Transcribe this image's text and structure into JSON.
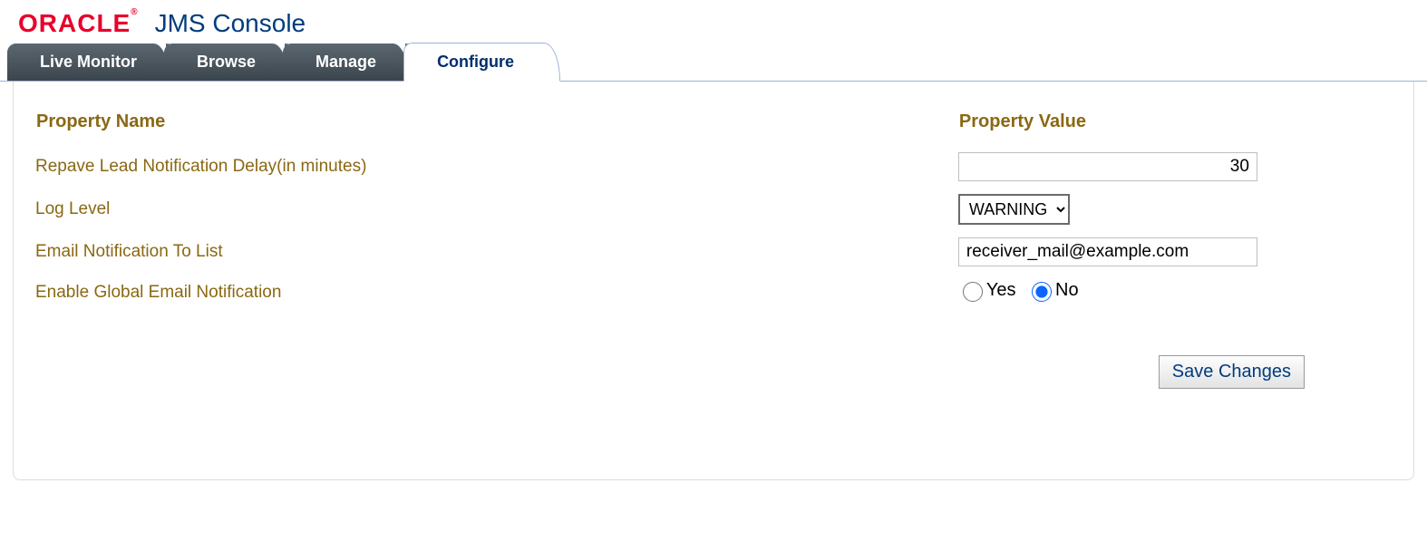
{
  "header": {
    "logo_text": "ORACLE",
    "logo_suffix": "®",
    "app_title": "JMS Console"
  },
  "tabs": [
    {
      "label": "Live Monitor",
      "active": false
    },
    {
      "label": "Browse",
      "active": false
    },
    {
      "label": "Manage",
      "active": false
    },
    {
      "label": "Configure",
      "active": true
    }
  ],
  "table": {
    "header_name": "Property Name",
    "header_value": "Property Value",
    "rows": {
      "delay": {
        "label": "Repave Lead Notification Delay(in minutes)",
        "value": "30"
      },
      "loglevel": {
        "label": "Log Level",
        "value": "WARNING"
      },
      "email_list": {
        "label": "Email Notification To List",
        "value": "receiver_mail@example.com"
      },
      "global_email": {
        "label": "Enable Global Email Notification",
        "yes_label": "Yes",
        "no_label": "No",
        "selected": "No"
      }
    }
  },
  "actions": {
    "save_label": "Save Changes"
  }
}
